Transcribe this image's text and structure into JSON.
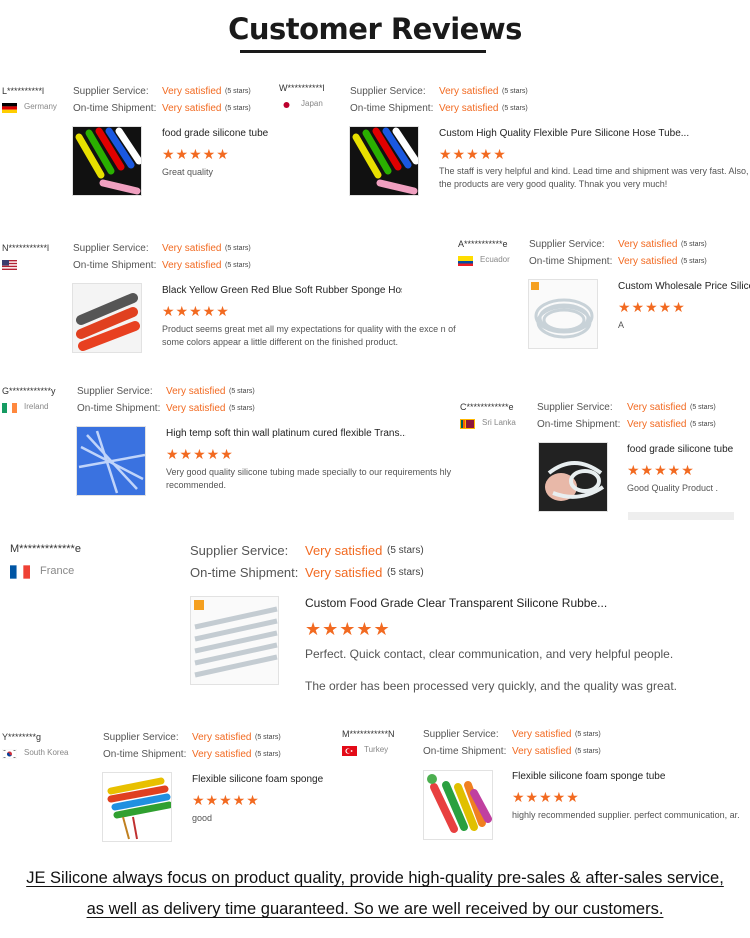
{
  "page": {
    "title": "Customer Reviews"
  },
  "labels": {
    "service": "Supplier Service:",
    "shipment": "On-time Shipment:"
  },
  "colors": {
    "accent": "#f26a21",
    "title": "#1a1a1a"
  },
  "reviews": [
    {
      "user": "L**********l",
      "country": "Germany",
      "flag": "germany",
      "service": "Very satisfied",
      "service_stars": "(5 stars)",
      "shipment": "Very satisfied",
      "shipment_stars": "(5 stars)",
      "product": "food grade silicone tube",
      "rating": 5,
      "text": "Great quality",
      "thumb": "colored-tubes"
    },
    {
      "user": "W**********l",
      "country": "Japan",
      "flag": "japan",
      "service": "Very satisfied",
      "service_stars": "(5 stars)",
      "shipment": "Very satisfied",
      "shipment_stars": "(5 stars)",
      "product": "Custom High Quality Flexible Pure Silicone Hose Tube...",
      "rating": 5,
      "text": "The staff is very helpful and kind. Lead time and shipment was very fast. Also, the products are very good quality. Thnak you very much!",
      "thumb": "colored-tubes"
    },
    {
      "user": "N***********l",
      "country": "",
      "flag": "usa",
      "service": "Very satisfied",
      "service_stars": "(5 stars)",
      "shipment": "Very satisfied",
      "shipment_stars": "(5 stars)",
      "product": "Black Yellow Green Red Blue Soft Rubber Sponge Hos...",
      "rating": 5,
      "text": "Product seems great met all my expectations for quality with the exce n of some colors appear a little different on the finished product.",
      "thumb": "sponge-hoses"
    },
    {
      "user": "A***********e",
      "country": "Ecuador",
      "flag": "ecuador",
      "service": "Very satisfied",
      "service_stars": "(5 stars)",
      "shipment": "Very satisfied",
      "shipment_stars": "(5 stars)",
      "product": "Custom Wholesale Price Silico",
      "rating": 5,
      "text": "A",
      "thumb": "clear-coil"
    },
    {
      "user": "G************y",
      "country": "Ireland",
      "flag": "ireland",
      "service": "Very satisfied",
      "service_stars": "(5 stars)",
      "shipment": "Very satisfied",
      "shipment_stars": "(5 stars)",
      "product": "High temp soft thin wall platinum cured flexible Trans...",
      "rating": 5,
      "text": "Very good quality silicone tubing made specially to our requirements hly recommended.",
      "thumb": "blue-tubes"
    },
    {
      "user": "C************e",
      "country": "Sri Lanka",
      "flag": "srilanka",
      "service": "Very satisfied",
      "service_stars": "(5 stars)",
      "shipment": "Very satisfied",
      "shipment_stars": "(5 stars)",
      "product": "food grade silicone tube",
      "rating": 5,
      "text": "Good Quality Product .",
      "thumb": "hand-tube"
    },
    {
      "user": "M*************e",
      "country": "France",
      "flag": "france",
      "service": "Very satisfied",
      "service_stars": "(5 stars)",
      "shipment": "Very satisfied",
      "shipment_stars": "(5 stars)",
      "product": "Custom Food Grade Clear Transparent Silicone Rubbe...",
      "rating": 5,
      "text": "Perfect. Quick contact, clear communication, and very helpful people.",
      "text2": "The order has been processed very quickly, and the quality was great.",
      "thumb": "clear-tubes"
    },
    {
      "user": "Y********g",
      "country": "South Korea",
      "flag": "korea",
      "service": "Very satisfied",
      "service_stars": "(5 stars)",
      "shipment": "Very satisfied",
      "shipment_stars": "(5 stars)",
      "product": "Flexible silicone foam sponge",
      "rating": 5,
      "text": "good",
      "thumb": "foam-handles"
    },
    {
      "user": "M***********N",
      "country": "Turkey",
      "flag": "turkey",
      "service": "Very satisfied",
      "service_stars": "(5 stars)",
      "shipment": "Very satisfied",
      "shipment_stars": "(5 stars)",
      "product": "Flexible silicone foam sponge tube",
      "rating": 5,
      "text": "highly recommended supplier. perfect communication, ar.",
      "thumb": "foam-tubes"
    }
  ],
  "footer": {
    "line1": "JE Silicone always focus on product quality, provide high-quality pre-sales & after-sales service,",
    "line2": "as well as delivery time guaranteed. So we are well received by our customers."
  }
}
